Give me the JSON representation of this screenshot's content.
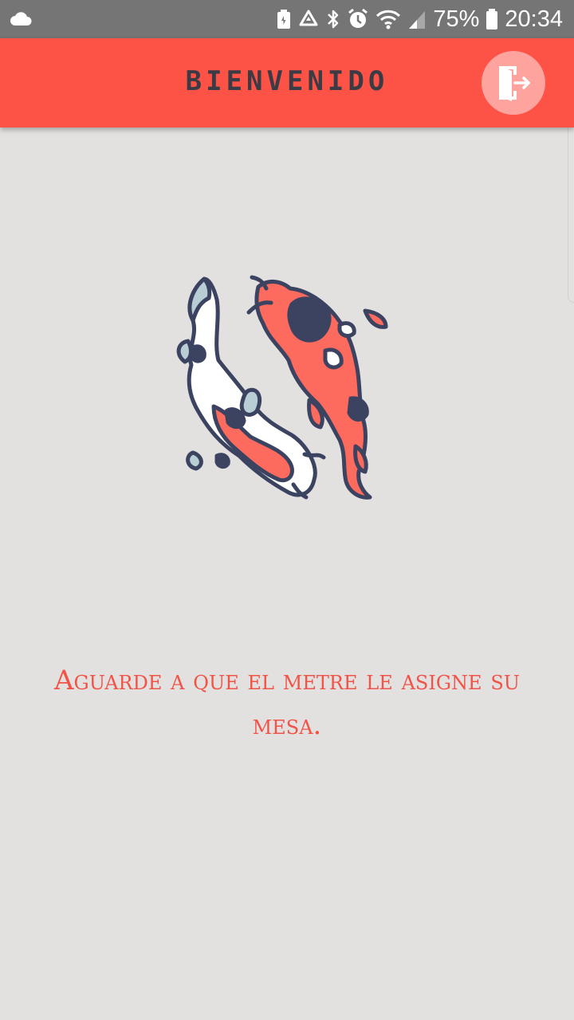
{
  "status_bar": {
    "battery_percent": "75%",
    "time": "20:34",
    "icons": [
      "cloud-icon",
      "battery-saver-icon",
      "recycle-icon",
      "bluetooth-icon",
      "alarm-icon",
      "wifi-icon",
      "signal-icon",
      "battery-icon"
    ]
  },
  "app_bar": {
    "title": "BIENVENIDO",
    "logout_icon": "exit-door-icon"
  },
  "main": {
    "illustration": "koi-fish-icon",
    "message": "Aguarde a que el metre le asigne su mesa."
  },
  "colors": {
    "status_bar": "#757575",
    "app_bar": "#fd5246",
    "logout_button": "#ffa39e",
    "background": "#e3e0e0",
    "message_text": "#f25347",
    "title_text": "#3b3b45"
  }
}
